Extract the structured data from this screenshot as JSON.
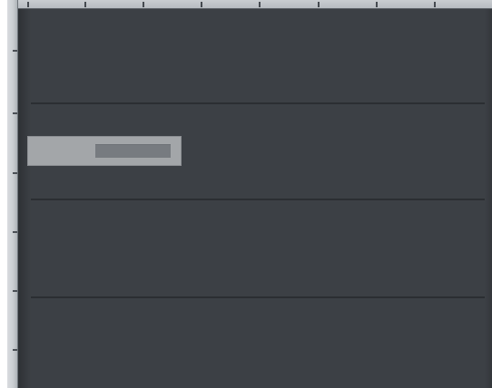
{
  "editor": {
    "background_color": "#3c4045",
    "lane_count": 4,
    "clip": {
      "label": "",
      "color": "#a3a6a9",
      "inner_color": "#777b80"
    }
  },
  "rulers": {
    "vertical": {
      "color": "#c9cdd1"
    },
    "horizontal": {
      "color": "#b7bcc1"
    }
  }
}
